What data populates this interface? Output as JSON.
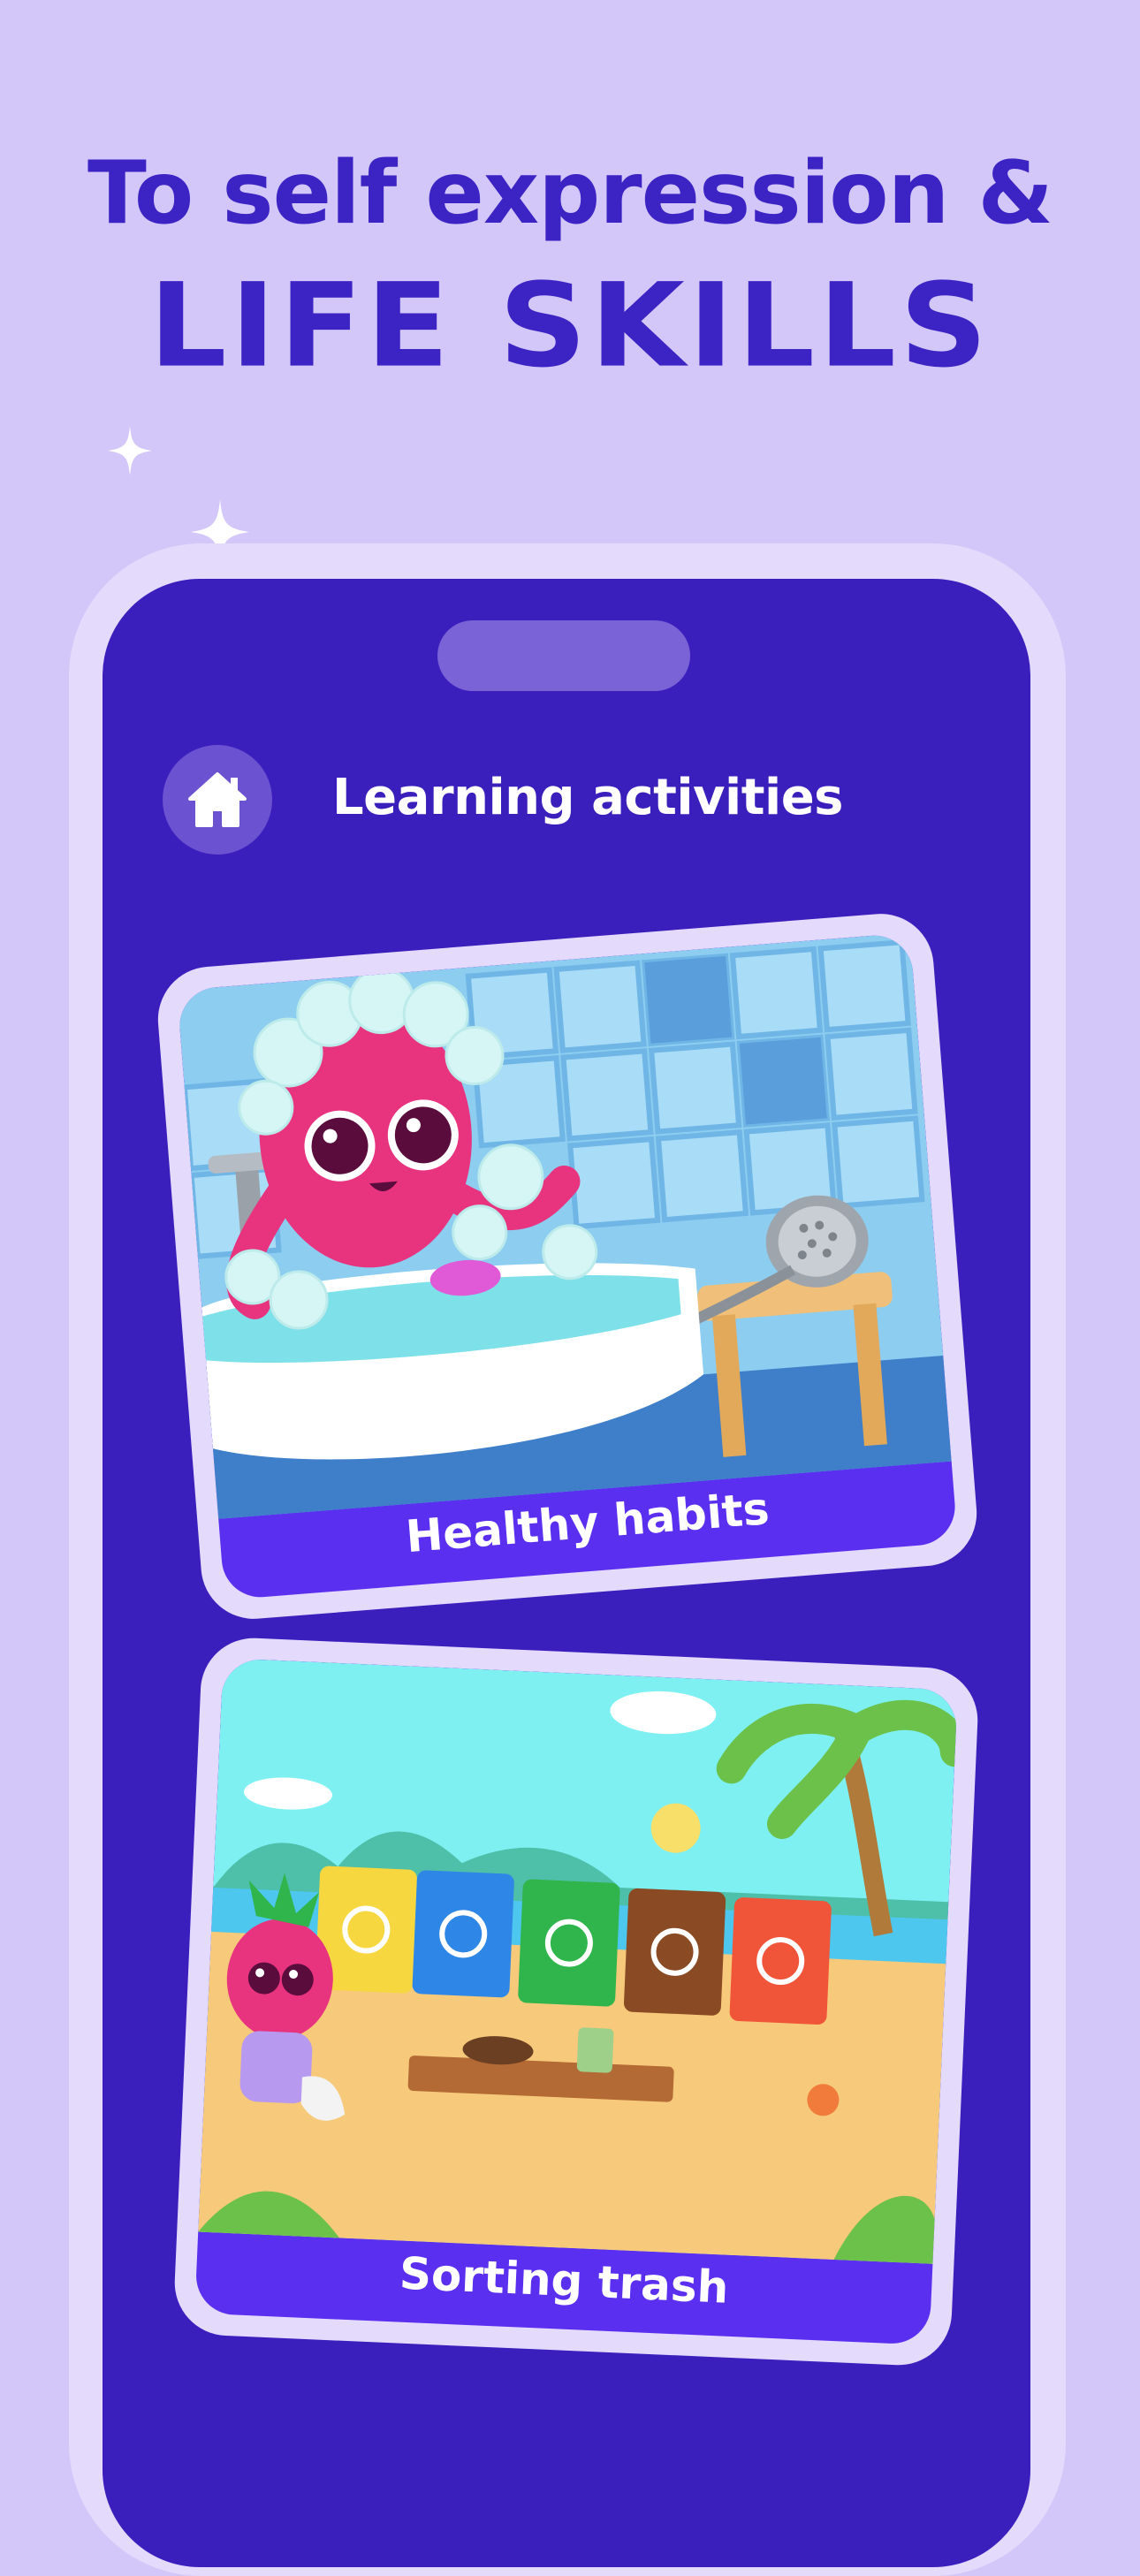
{
  "headline": {
    "line1": "To self expression &",
    "line2": "LIFE SKILLS"
  },
  "colors": {
    "background": "#d3c6f8",
    "headline": "#3b23c4",
    "screen": "#3a1fbd",
    "card_label_bg": "#5b2ff0"
  },
  "screen": {
    "title": "Learning activities",
    "home_icon": "home-icon"
  },
  "cards": [
    {
      "label": "Healthy habits"
    },
    {
      "label": "Sorting trash"
    }
  ]
}
